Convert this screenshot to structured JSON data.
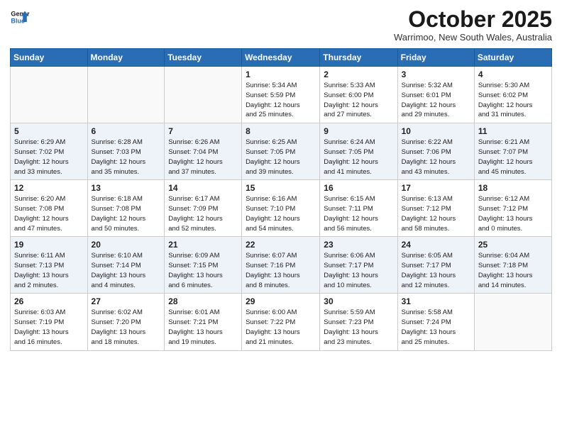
{
  "header": {
    "logo_line1": "General",
    "logo_line2": "Blue",
    "month": "October 2025",
    "location": "Warrimoo, New South Wales, Australia"
  },
  "weekdays": [
    "Sunday",
    "Monday",
    "Tuesday",
    "Wednesday",
    "Thursday",
    "Friday",
    "Saturday"
  ],
  "weeks": [
    [
      {
        "day": "",
        "info": ""
      },
      {
        "day": "",
        "info": ""
      },
      {
        "day": "",
        "info": ""
      },
      {
        "day": "1",
        "info": "Sunrise: 5:34 AM\nSunset: 5:59 PM\nDaylight: 12 hours\nand 25 minutes."
      },
      {
        "day": "2",
        "info": "Sunrise: 5:33 AM\nSunset: 6:00 PM\nDaylight: 12 hours\nand 27 minutes."
      },
      {
        "day": "3",
        "info": "Sunrise: 5:32 AM\nSunset: 6:01 PM\nDaylight: 12 hours\nand 29 minutes."
      },
      {
        "day": "4",
        "info": "Sunrise: 5:30 AM\nSunset: 6:02 PM\nDaylight: 12 hours\nand 31 minutes."
      }
    ],
    [
      {
        "day": "5",
        "info": "Sunrise: 6:29 AM\nSunset: 7:02 PM\nDaylight: 12 hours\nand 33 minutes."
      },
      {
        "day": "6",
        "info": "Sunrise: 6:28 AM\nSunset: 7:03 PM\nDaylight: 12 hours\nand 35 minutes."
      },
      {
        "day": "7",
        "info": "Sunrise: 6:26 AM\nSunset: 7:04 PM\nDaylight: 12 hours\nand 37 minutes."
      },
      {
        "day": "8",
        "info": "Sunrise: 6:25 AM\nSunset: 7:05 PM\nDaylight: 12 hours\nand 39 minutes."
      },
      {
        "day": "9",
        "info": "Sunrise: 6:24 AM\nSunset: 7:05 PM\nDaylight: 12 hours\nand 41 minutes."
      },
      {
        "day": "10",
        "info": "Sunrise: 6:22 AM\nSunset: 7:06 PM\nDaylight: 12 hours\nand 43 minutes."
      },
      {
        "day": "11",
        "info": "Sunrise: 6:21 AM\nSunset: 7:07 PM\nDaylight: 12 hours\nand 45 minutes."
      }
    ],
    [
      {
        "day": "12",
        "info": "Sunrise: 6:20 AM\nSunset: 7:08 PM\nDaylight: 12 hours\nand 47 minutes."
      },
      {
        "day": "13",
        "info": "Sunrise: 6:18 AM\nSunset: 7:08 PM\nDaylight: 12 hours\nand 50 minutes."
      },
      {
        "day": "14",
        "info": "Sunrise: 6:17 AM\nSunset: 7:09 PM\nDaylight: 12 hours\nand 52 minutes."
      },
      {
        "day": "15",
        "info": "Sunrise: 6:16 AM\nSunset: 7:10 PM\nDaylight: 12 hours\nand 54 minutes."
      },
      {
        "day": "16",
        "info": "Sunrise: 6:15 AM\nSunset: 7:11 PM\nDaylight: 12 hours\nand 56 minutes."
      },
      {
        "day": "17",
        "info": "Sunrise: 6:13 AM\nSunset: 7:12 PM\nDaylight: 12 hours\nand 58 minutes."
      },
      {
        "day": "18",
        "info": "Sunrise: 6:12 AM\nSunset: 7:12 PM\nDaylight: 13 hours\nand 0 minutes."
      }
    ],
    [
      {
        "day": "19",
        "info": "Sunrise: 6:11 AM\nSunset: 7:13 PM\nDaylight: 13 hours\nand 2 minutes."
      },
      {
        "day": "20",
        "info": "Sunrise: 6:10 AM\nSunset: 7:14 PM\nDaylight: 13 hours\nand 4 minutes."
      },
      {
        "day": "21",
        "info": "Sunrise: 6:09 AM\nSunset: 7:15 PM\nDaylight: 13 hours\nand 6 minutes."
      },
      {
        "day": "22",
        "info": "Sunrise: 6:07 AM\nSunset: 7:16 PM\nDaylight: 13 hours\nand 8 minutes."
      },
      {
        "day": "23",
        "info": "Sunrise: 6:06 AM\nSunset: 7:17 PM\nDaylight: 13 hours\nand 10 minutes."
      },
      {
        "day": "24",
        "info": "Sunrise: 6:05 AM\nSunset: 7:17 PM\nDaylight: 13 hours\nand 12 minutes."
      },
      {
        "day": "25",
        "info": "Sunrise: 6:04 AM\nSunset: 7:18 PM\nDaylight: 13 hours\nand 14 minutes."
      }
    ],
    [
      {
        "day": "26",
        "info": "Sunrise: 6:03 AM\nSunset: 7:19 PM\nDaylight: 13 hours\nand 16 minutes."
      },
      {
        "day": "27",
        "info": "Sunrise: 6:02 AM\nSunset: 7:20 PM\nDaylight: 13 hours\nand 18 minutes."
      },
      {
        "day": "28",
        "info": "Sunrise: 6:01 AM\nSunset: 7:21 PM\nDaylight: 13 hours\nand 19 minutes."
      },
      {
        "day": "29",
        "info": "Sunrise: 6:00 AM\nSunset: 7:22 PM\nDaylight: 13 hours\nand 21 minutes."
      },
      {
        "day": "30",
        "info": "Sunrise: 5:59 AM\nSunset: 7:23 PM\nDaylight: 13 hours\nand 23 minutes."
      },
      {
        "day": "31",
        "info": "Sunrise: 5:58 AM\nSunset: 7:24 PM\nDaylight: 13 hours\nand 25 minutes."
      },
      {
        "day": "",
        "info": ""
      }
    ]
  ]
}
